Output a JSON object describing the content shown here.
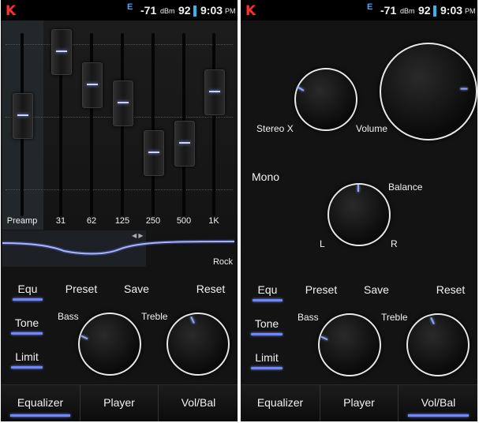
{
  "status": {
    "signal": "-71",
    "signal_unit": "dBm",
    "battery": "92",
    "time": "9:03",
    "ampm": "PM",
    "app_icon": "K",
    "e_icon": "E"
  },
  "equalizer": {
    "bands": [
      {
        "label": "Preamp",
        "level": 0.55
      },
      {
        "label": "31",
        "level": 0.9
      },
      {
        "label": "62",
        "level": 0.72
      },
      {
        "label": "125",
        "level": 0.62
      },
      {
        "label": "250",
        "level": 0.35
      },
      {
        "label": "500",
        "level": 0.4
      },
      {
        "label": "1K",
        "level": 0.68
      }
    ],
    "preset_name": "Rock"
  },
  "controls": {
    "equ": "Equ",
    "preset": "Preset",
    "save": "Save",
    "reset": "Reset",
    "tone": "Tone",
    "limit": "Limit",
    "bass": "Bass",
    "treble": "Treble"
  },
  "volbal": {
    "stereo_x": "Stereo X",
    "volume": "Volume",
    "mono": "Mono",
    "balance": "Balance",
    "left": "L",
    "right": "R"
  },
  "tabs": {
    "equalizer": "Equalizer",
    "player": "Player",
    "volbal": "Vol/Bal"
  },
  "colors": {
    "accent": "#6f86ff",
    "background": "#131313",
    "battery": "#31b6e7",
    "app_icon": "#ff3030"
  }
}
